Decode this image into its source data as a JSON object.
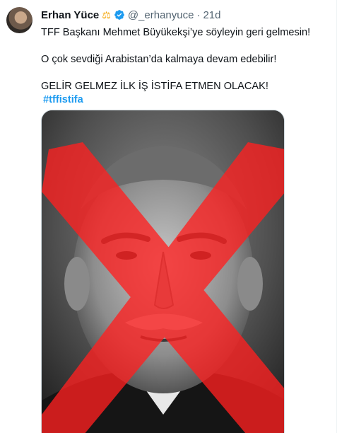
{
  "tweet": {
    "author": {
      "display_name": "Erhan Yüce",
      "badge_icon": "scales-icon",
      "verified_icon": "verified-badge-icon",
      "handle": "@_erhanyuce",
      "separator": "·",
      "time": "21d"
    },
    "text": {
      "line1": "TFF Başkanı Mehmet Büyükekşi’ye söyleyin geri gelmesin!",
      "line2": "O çok sevdiği Arabistan’da kalmaya devam edebilir!",
      "line3": "GELİR GELMEZ İLK İŞ İSTİFA ETMEN OLACAK!",
      "hashtag": "#tffistifa"
    },
    "media": {
      "description_icon": "photo-of-man-crossed-out-with-red-x"
    }
  },
  "colors": {
    "accent": "#1d9bf0",
    "text": "#0f1419",
    "muted": "#536471",
    "cross": "#ff2020"
  }
}
